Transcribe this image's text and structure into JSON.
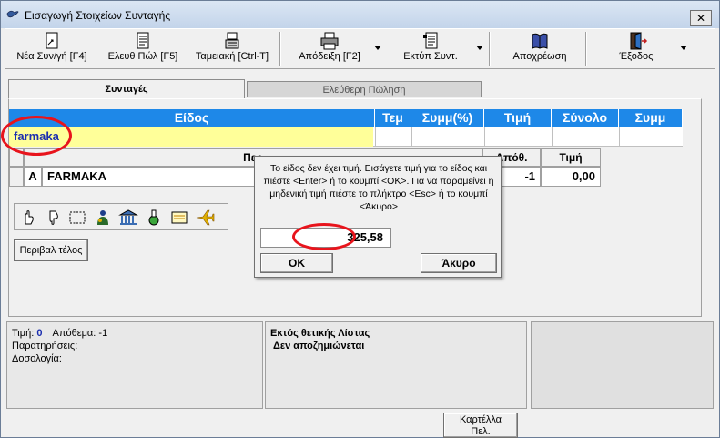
{
  "window": {
    "title": "Εισαγωγή Στοιχείων Συνταγής",
    "close": "✕"
  },
  "toolbar": {
    "new_prescription": "Νέα Συν/γή [F4]",
    "free_sale": "Ελευθ Πώλ [F5]",
    "cash_register": "Ταμειακή [Ctrl-T]",
    "receipt": "Απόδειξη [F2]",
    "print_prescription": "Εκτύπ Συντ.",
    "debit": "Αποχρέωση",
    "exit": "Έξοδος"
  },
  "tabs": {
    "prescriptions": "Συνταγές",
    "free_sale": "Ελεύθερη Πώληση"
  },
  "grid": {
    "headers": [
      "Είδος",
      "Τεμ",
      "Συμμ(%)",
      "Τιμή",
      "Σύνολο",
      "Συμμ"
    ],
    "search_value": "farmaka"
  },
  "subtable": {
    "headers": {
      "description": "Περ",
      "stock": "Απόθ.",
      "price": "Τιμή"
    },
    "row": {
      "flag": "A",
      "name": "FARMAKA",
      "stock": "-1",
      "price": "0,00"
    }
  },
  "fee_button": "Περιβαλ τέλος",
  "dialog": {
    "message": "Το είδος δεν έχει τιμή.  Εισάγετε τιμή για το είδος και πιέστε <Enter> ή το κουμπί <OK>. Για να παραμείνει η μηδενική τιμή πιέστε το πλήκτρο <Esc> ή το κουμπί <Άκυρο>",
    "value": "325,58",
    "ok": "OK",
    "cancel": "Άκυρο"
  },
  "bottom": {
    "price_label": "Τιμή:",
    "price_value": "0",
    "stock_label": "Απόθεμα: -1",
    "notes_label": "Παρατηρήσεις:",
    "dosage_label": "Δοσολογία:",
    "list_title": "Εκτός θετικής Λίστας",
    "list_status": "Δεν αποζημιώνεται",
    "card_button": "Καρτέλλα\nΠελ."
  },
  "colors": {
    "grid_header": "#1e88e8",
    "search_cell": "#ffff99",
    "annotation_red": "#e8141c"
  }
}
